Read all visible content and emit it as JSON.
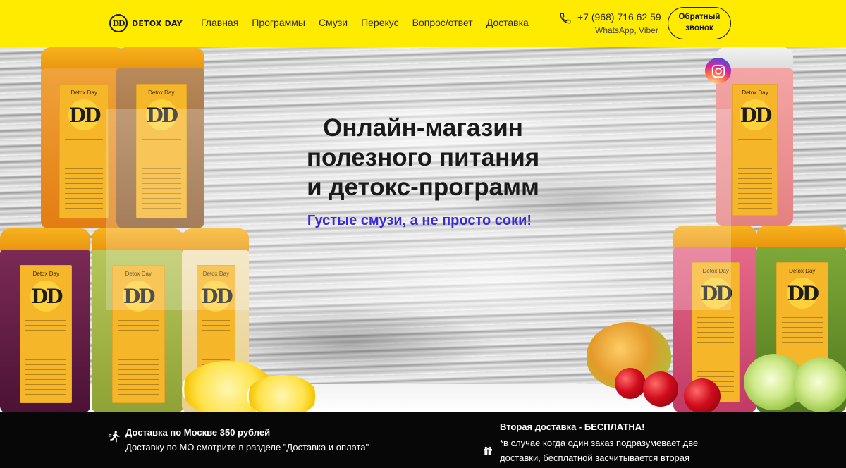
{
  "colors": {
    "header_bg": "#ffeb00",
    "info_bar_bg": "#070707",
    "subtitle": "#3a2ad6",
    "jar_lid": "#f7b21e",
    "jar_label": "#f6b62a"
  },
  "header": {
    "logo": {
      "mark": "DD",
      "text": "DETOX DAY"
    },
    "nav": [
      {
        "label": "Главная"
      },
      {
        "label": "Программы"
      },
      {
        "label": "Смузи"
      },
      {
        "label": "Перекус"
      },
      {
        "label": "Вопрос/ответ"
      },
      {
        "label": "Доставка"
      }
    ],
    "phone": {
      "icon": "phone-icon",
      "number": "+7 (968) 716 62 59",
      "messengers": "WhatsApp, Viber"
    },
    "callback_button": {
      "line1": "Обратный",
      "line2": "звонок"
    }
  },
  "hero": {
    "title_line1": "Онлайн-магазин",
    "title_line2": "полезного питания",
    "title_line3": "и детокс-программ",
    "subtitle": "Густые смузи, а не просто соки!",
    "instagram_icon": "instagram-icon",
    "jar_brand": "Detox Day",
    "jar_mark": "DD"
  },
  "info_bar": {
    "left": {
      "icon": "courier-runner-icon",
      "title": "Доставка по Москве 350 рублей",
      "text": "Доставку по МО смотрите в разделе \"Доставка и оплата\""
    },
    "right": {
      "icon": "gift-icon",
      "title": "Вторая доставка - БЕСПЛАТНА!",
      "text": "*в случае когда один заказ подразумевает две доставки, бесплатной засчитывается вторая"
    }
  }
}
